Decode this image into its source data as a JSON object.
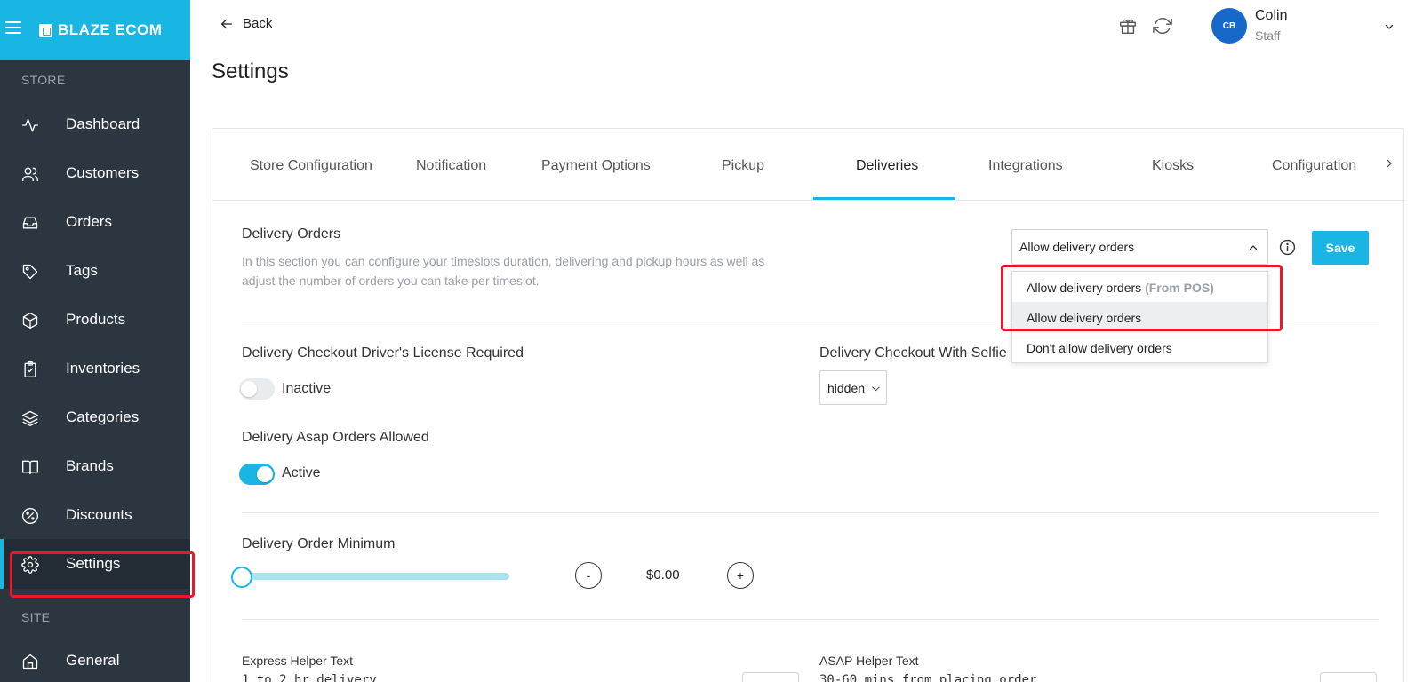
{
  "app": {
    "brand": "BLAZE ECOM"
  },
  "sidebar": {
    "store_label": "STORE",
    "site_label": "SITE",
    "items": [
      {
        "label": "Dashboard",
        "icon": "activity-icon"
      },
      {
        "label": "Customers",
        "icon": "users-icon"
      },
      {
        "label": "Orders",
        "icon": "inbox-icon"
      },
      {
        "label": "Tags",
        "icon": "tag-icon"
      },
      {
        "label": "Products",
        "icon": "box-icon"
      },
      {
        "label": "Inventories",
        "icon": "clipboard-icon"
      },
      {
        "label": "Categories",
        "icon": "layers-icon"
      },
      {
        "label": "Brands",
        "icon": "book-icon"
      },
      {
        "label": "Discounts",
        "icon": "percent-icon"
      },
      {
        "label": "Settings",
        "icon": "gear-icon",
        "active": true
      }
    ],
    "site_items": [
      {
        "label": "General",
        "icon": "home-icon"
      }
    ]
  },
  "header": {
    "back_label": "Back",
    "title": "Settings",
    "user": {
      "initials": "CB",
      "name": "Colin",
      "role": "Staff"
    }
  },
  "tabs": [
    {
      "label": "Store Configuration"
    },
    {
      "label": "Notification"
    },
    {
      "label": "Payment Options"
    },
    {
      "label": "Pickup"
    },
    {
      "label": "Deliveries",
      "active": true
    },
    {
      "label": "Integrations"
    },
    {
      "label": "Kiosks"
    },
    {
      "label": "Configuration"
    }
  ],
  "delivery_orders": {
    "title": "Delivery Orders",
    "description": "In this section you can configure your timeslots duration, delivering and pickup hours as well as adjust the number of orders you can take per timeslot.",
    "selected": "Allow delivery orders",
    "save_label": "Save",
    "options": [
      {
        "label": "Allow delivery orders",
        "suffix": "(From POS)"
      },
      {
        "label": "Allow delivery orders",
        "selected": true
      },
      {
        "label": "Don't allow delivery orders"
      }
    ]
  },
  "license_required": {
    "title": "Delivery Checkout Driver's License Required",
    "state": "Inactive",
    "enabled": false
  },
  "selfie": {
    "title": "Delivery Checkout With Selfie",
    "value": "hidden"
  },
  "asap_allowed": {
    "title": "Delivery Asap Orders Allowed",
    "state": "Active",
    "enabled": true
  },
  "order_minimum": {
    "title": "Delivery Order Minimum",
    "amount": "$0.00",
    "minus": "-",
    "plus": "+",
    "slider_fraction": 0
  },
  "express_helper": {
    "label": "Express Helper Text",
    "value": "1 to 2 hr delivery"
  },
  "asap_helper": {
    "label": "ASAP Helper Text",
    "value": "30-60 mins from placing order"
  },
  "colors": {
    "accent": "#19b6e3",
    "sidebar": "#2c3641",
    "highlight": "#e8192c",
    "avatar": "#1668c9"
  }
}
